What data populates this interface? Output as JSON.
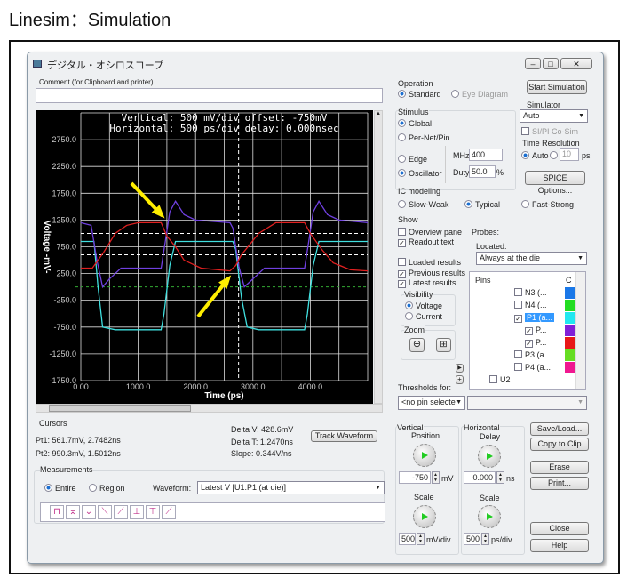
{
  "page_title": "Linesim：Simulation",
  "window": {
    "title": "デジタル・オシロスコープ",
    "comment_label": "Comment (for Clipboard and printer)",
    "comment_value": ""
  },
  "scope": {
    "readout_line1": "Vertical: 500 mV/div  offset: -750mV",
    "readout_line2": "Horizontal: 500 ps/div  delay: 0.000nsec"
  },
  "chart_data": {
    "type": "line",
    "xlabel": "Time  (ps)",
    "ylabel": "Voltage  -mV-",
    "xlim": [
      0,
      5000
    ],
    "ylim": [
      -1750,
      3250
    ],
    "x_ticks": [
      "0.00",
      "1000.0",
      "2000.0",
      "3000.0",
      "4000.0"
    ],
    "y_ticks": [
      "2750.0",
      "2250.0",
      "1750.0",
      "1250.0",
      "750.0",
      "250.0",
      "-250.0",
      "-750.0",
      "-1250.0",
      "-1750.0"
    ],
    "grid": true,
    "background": "#000000",
    "series": [
      {
        "color": "#40e0e0",
        "x": [
          0,
          230,
          300,
          380,
          600,
          1400,
          1450,
          1550,
          1650,
          2650,
          2700,
          2800,
          2900,
          3100,
          3900,
          3950,
          4050,
          4150,
          5000
        ],
        "y": [
          850,
          850,
          0,
          -750,
          -800,
          -800,
          -500,
          400,
          850,
          850,
          700,
          -200,
          -750,
          -800,
          -800,
          -500,
          400,
          850,
          850
        ]
      },
      {
        "color": "#7040e0",
        "x": [
          0,
          180,
          280,
          380,
          500,
          700,
          1400,
          1480,
          1550,
          1650,
          1800,
          2000,
          2600,
          2650,
          2750,
          2850,
          3000,
          3200,
          3900,
          3980,
          4050,
          4150,
          4300,
          4500,
          5000
        ],
        "y": [
          1200,
          1150,
          500,
          0,
          150,
          350,
          350,
          900,
          1400,
          1600,
          1350,
          1250,
          1200,
          1100,
          400,
          0,
          150,
          350,
          350,
          900,
          1400,
          1600,
          1350,
          1250,
          1200
        ]
      },
      {
        "color": "#e02020",
        "x": [
          0,
          200,
          400,
          600,
          800,
          1000,
          1400,
          1500,
          1650,
          1800,
          2100,
          2600,
          2700,
          2800,
          2950,
          3100,
          3400,
          3900,
          4000,
          4200,
          4400,
          4700,
          5000
        ],
        "y": [
          350,
          350,
          650,
          1000,
          1150,
          1200,
          1200,
          950,
          750,
          500,
          350,
          300,
          400,
          600,
          800,
          1000,
          1200,
          1200,
          1000,
          700,
          450,
          320,
          300
        ]
      }
    ],
    "reference_lines": {
      "dashed_white_mV": [
        1000,
        600
      ],
      "dashed_green_mV": [
        0
      ],
      "cursor_ps": [
        2750
      ]
    }
  },
  "cursors": {
    "label": "Cursors",
    "pt1": "Pt1: 561.7mV, 2.7482ns",
    "pt2": "Pt2: 990.3mV, 1.5012ns",
    "delta_v": "Delta V: 428.6mV",
    "delta_t": "Delta T: 1.2470ns",
    "slope": "Slope: 0.344V/ns",
    "track_button": "Track Waveform"
  },
  "measurements": {
    "label": "Measurements",
    "entire": "Entire",
    "region": "Region",
    "waveform_label": "Waveform:",
    "waveform_value": "Latest V [U1.P1 (at die)]"
  },
  "operation": {
    "label": "Operation",
    "standard": "Standard",
    "eye": "Eye Diagram"
  },
  "start_button": "Start Simulation",
  "simulator": {
    "label": "Simulator",
    "value": "Auto",
    "cosim": "SI/PI Co-Sim",
    "time_res_label": "Time Resolution",
    "auto": "Auto",
    "res_value": "10",
    "res_unit": "ps"
  },
  "stimulus": {
    "label": "Stimulus",
    "global": "Global",
    "pernet": "Per-Net/Pin",
    "edge": "Edge",
    "oscillator": "Oscillator",
    "mhz_label": "MHz",
    "mhz_value": "400",
    "duty_label": "Duty",
    "duty_value": "50.0",
    "duty_unit": "%"
  },
  "spice_button": "SPICE Options...",
  "ic_modeling": {
    "label": "IC modeling",
    "slow": "Slow-Weak",
    "typical": "Typical",
    "fast": "Fast-Strong"
  },
  "show": {
    "label": "Show",
    "overview": "Overview pane",
    "readout": "Readout text",
    "loaded": "Loaded results",
    "previous": "Previous results",
    "latest": "Latest results",
    "visibility": "Visibility",
    "voltage": "Voltage",
    "current": "Current",
    "zoom": "Zoom"
  },
  "probes": {
    "label": "Probes:",
    "located_label": "Located:",
    "located_value": "Always at the die",
    "pins_header": "Pins",
    "col2": "C",
    "pins": [
      {
        "label": "N3 (...",
        "color": "#1a78e8",
        "checked": false
      },
      {
        "label": "N4 (...",
        "color": "#22dd22",
        "checked": false
      },
      {
        "label": "P1 (a...",
        "color": "#22e8f0",
        "checked": true,
        "selected": true
      },
      {
        "label": "P...",
        "color": "#8020d8",
        "checked": true
      },
      {
        "label": "P...",
        "color": "#e81818",
        "checked": true
      },
      {
        "label": "P3 (a...",
        "color": "#66dd22",
        "checked": false
      },
      {
        "label": "P4 (a...",
        "color": "#f01890",
        "checked": false
      },
      {
        "label": "U2",
        "color": "",
        "checked": false
      }
    ]
  },
  "thresholds": {
    "label": "Thresholds for:",
    "value": "<no pin selecte"
  },
  "vertical": {
    "label1": "Vertical",
    "label2": "Position",
    "pos_value": "-750",
    "pos_unit": "mV",
    "scale_label": "Scale",
    "scale_value": "500",
    "scale_unit": "mV/div"
  },
  "horizontal": {
    "label1": "Horizontal",
    "label2": "Delay",
    "delay_value": "0.000",
    "delay_unit": "ns",
    "scale_label": "Scale",
    "scale_value": "500",
    "scale_unit": "ps/div"
  },
  "buttons": {
    "save": "Save/Load...",
    "copy": "Copy to Clip",
    "erase": "Erase",
    "print": "Print...",
    "close": "Close",
    "help": "Help"
  }
}
